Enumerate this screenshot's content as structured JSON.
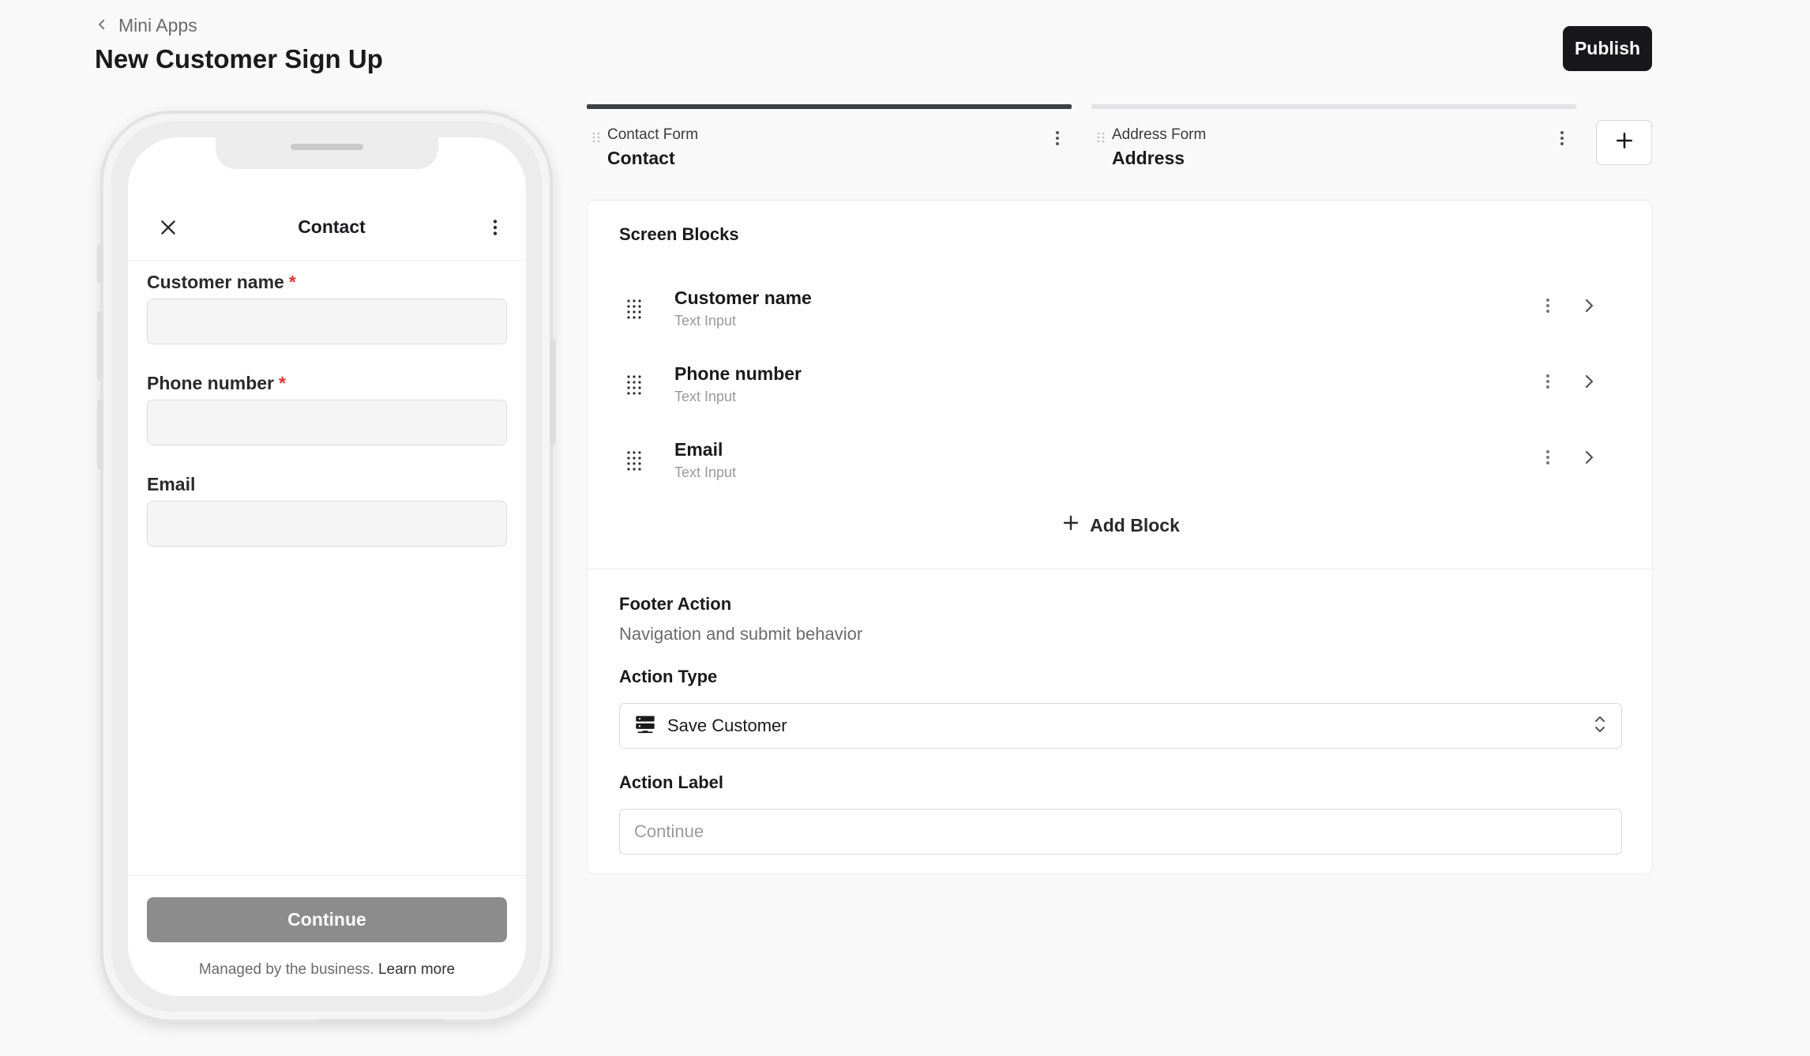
{
  "header": {
    "breadcrumb": "Mini Apps",
    "title": "New Customer Sign Up",
    "publish_label": "Publish"
  },
  "phone": {
    "screen_title": "Contact",
    "fields": [
      {
        "label": "Customer name",
        "required": "*"
      },
      {
        "label": "Phone number",
        "required": "*"
      },
      {
        "label": "Email"
      }
    ],
    "continue_label": "Continue",
    "managed_text": "Managed by the business.",
    "learn_more": "Learn more"
  },
  "tabs": [
    {
      "caption": "Contact Form",
      "name": "Contact",
      "active": true
    },
    {
      "caption": "Address Form",
      "name": "Address",
      "active": false
    }
  ],
  "screen_blocks": {
    "title": "Screen Blocks",
    "items": [
      {
        "name": "Customer name",
        "type": "Text Input"
      },
      {
        "name": "Phone number",
        "type": "Text Input"
      },
      {
        "name": "Email",
        "type": "Text Input"
      }
    ],
    "add_label": "Add Block"
  },
  "footer_action": {
    "title": "Footer Action",
    "subtitle": "Navigation and submit behavior",
    "action_type_label": "Action Type",
    "action_type_value": "Save Customer",
    "action_label_label": "Action Label",
    "action_label_placeholder": "Continue"
  },
  "colors": {
    "accent": "#18181b",
    "tab_active": "#3f3f46",
    "tab_inactive": "#e4e4e7",
    "required": "#d93636",
    "disabled_button": "#8c8c8c"
  }
}
